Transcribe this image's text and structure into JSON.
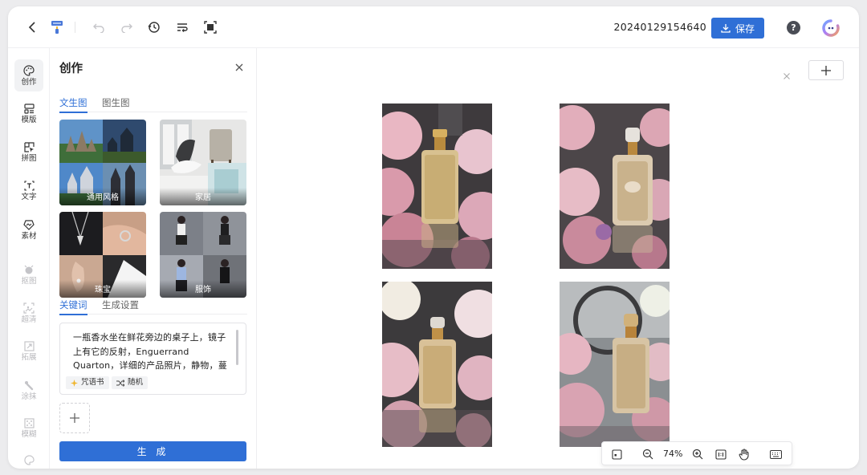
{
  "header": {
    "doc_title": "20240129154640",
    "save_label": "保存",
    "help_label": "?"
  },
  "rail": {
    "items": [
      {
        "label": "创作",
        "icon": "palette-icon",
        "active": true
      },
      {
        "label": "模版",
        "icon": "template-icon"
      },
      {
        "label": "拼图",
        "icon": "collage-icon"
      },
      {
        "label": "文字",
        "icon": "text-icon"
      },
      {
        "label": "素材",
        "icon": "assets-icon"
      },
      {
        "label": "抠图",
        "icon": "cutout-icon",
        "disabled": true
      },
      {
        "label": "超清",
        "icon": "upscale-icon",
        "disabled": true
      },
      {
        "label": "拓展",
        "icon": "expand-icon",
        "disabled": true
      },
      {
        "label": "涂抹",
        "icon": "brush-icon",
        "disabled": true
      },
      {
        "label": "模糊",
        "icon": "blur-icon",
        "disabled": true
      }
    ]
  },
  "panel": {
    "title": "创作",
    "mode_tabs": [
      {
        "label": "文生图",
        "active": true
      },
      {
        "label": "图生图"
      }
    ],
    "styles": [
      {
        "label": "通用风格"
      },
      {
        "label": "家居"
      },
      {
        "label": "珠宝"
      },
      {
        "label": "服饰"
      }
    ],
    "prompt_tabs": [
      {
        "label": "关键词",
        "active": true
      },
      {
        "label": "生成设置"
      }
    ],
    "prompt_text": "一瓶香水坐在鲜花旁边的桌子上，镜子上有它的反射，Enguerrand Quarton，详细的产品照片，静物，蔓藤花纹，高",
    "chips": [
      {
        "label": "咒语书",
        "icon": "sparkle-icon"
      },
      {
        "label": "随机",
        "icon": "shuffle-icon"
      }
    ],
    "generate_label": "生 成"
  },
  "canvas": {
    "zoom": "74%",
    "images": [
      {
        "name": "perfume-image-1"
      },
      {
        "name": "perfume-image-2"
      },
      {
        "name": "perfume-image-3"
      },
      {
        "name": "perfume-image-4"
      }
    ]
  },
  "colors": {
    "accent": "#2f6fd6",
    "text": "#222222",
    "muted": "#666666"
  }
}
